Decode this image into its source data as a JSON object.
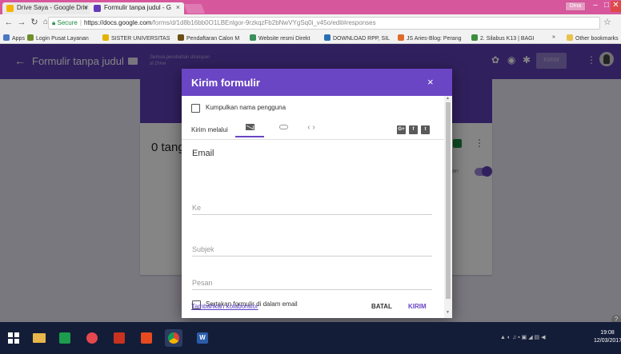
{
  "browser": {
    "tabs": [
      {
        "label": "Drive Saya - Google Driv",
        "close": "×",
        "favicon_color": "#f4b400"
      },
      {
        "label": "Formulir tanpa judul - G",
        "close": "×",
        "favicon_color": "#673ab7"
      }
    ],
    "user_chip": "Dina",
    "window_controls": {
      "minimize": "–",
      "maximize": "□",
      "close": "✕"
    },
    "url": {
      "secure_label": "Secure",
      "host": "https://docs.google.com",
      "path": "/forms/d/1d8b16bb0O1LBEnlgor-9rzkqzFb2bNwVYgSq0i_v45o/edit#responses"
    },
    "bookmarks": [
      {
        "label": "Apps",
        "icon_color": "#4a78c2"
      },
      {
        "label": "Login Pusat Layanan",
        "icon_color": "#6e8f2a"
      },
      {
        "label": "SISTER UNIVERSITAS",
        "icon_color": "#e4b300"
      },
      {
        "label": "Pendaftaran Calon M",
        "icon_color": "#6b4f12"
      },
      {
        "label": "Website resmi Direkt",
        "icon_color": "#3a8f5a"
      },
      {
        "label": "DOWNLOAD RPP, SIL",
        "icon_color": "#2a6fb6"
      },
      {
        "label": "JS Aries-Blog: Perang",
        "icon_color": "#e06a2a"
      },
      {
        "label": "2. Silabus K13 | BAGI",
        "icon_color": "#3c8f3c"
      },
      {
        "label": "»",
        "icon_color": ""
      },
      {
        "label": "Other bookmarks",
        "icon_color": "#e8c24a"
      }
    ]
  },
  "app": {
    "title": "Formulir tanpa judul",
    "saved_note": "Semua perubahan disimpan di Drive",
    "send_button": "KIRIM",
    "accent_color": "#5e3eb4"
  },
  "responses": {
    "count_text": "0 tang",
    "accepting_label": "an"
  },
  "dialog": {
    "title": "Kirim formulir",
    "close": "×",
    "collect_email_label": "Kumpulkan nama pengguna",
    "send_via_label": "Kirim melalui",
    "embed_glyph": "‹ ›",
    "social": {
      "gplus": "G+",
      "facebook": "f",
      "twitter": "t"
    },
    "email_heading": "Email",
    "fields": {
      "to_placeholder": "Ke",
      "subject_placeholder": "Subjek",
      "message_placeholder": "Pesan"
    },
    "include_form_label": "Sertakan formulir di dalam email",
    "add_collaborators": "Tambahkan kolaborator",
    "cancel": "BATAL",
    "send": "KIRIM"
  },
  "taskbar": {
    "apps": [
      {
        "name": "file-explorer",
        "color": "#e8b64a"
      },
      {
        "name": "store",
        "color": "#1c9c4c"
      },
      {
        "name": "photo-app",
        "color": "#e5484d"
      },
      {
        "name": "pdf-reader",
        "color": "#c8321e"
      },
      {
        "name": "office-app",
        "color": "#e54b1f"
      },
      {
        "name": "chrome",
        "color": "#f1c40f"
      },
      {
        "name": "word",
        "color": "#2b5caa"
      }
    ],
    "time": "19:08",
    "date": "12/03/2017"
  }
}
